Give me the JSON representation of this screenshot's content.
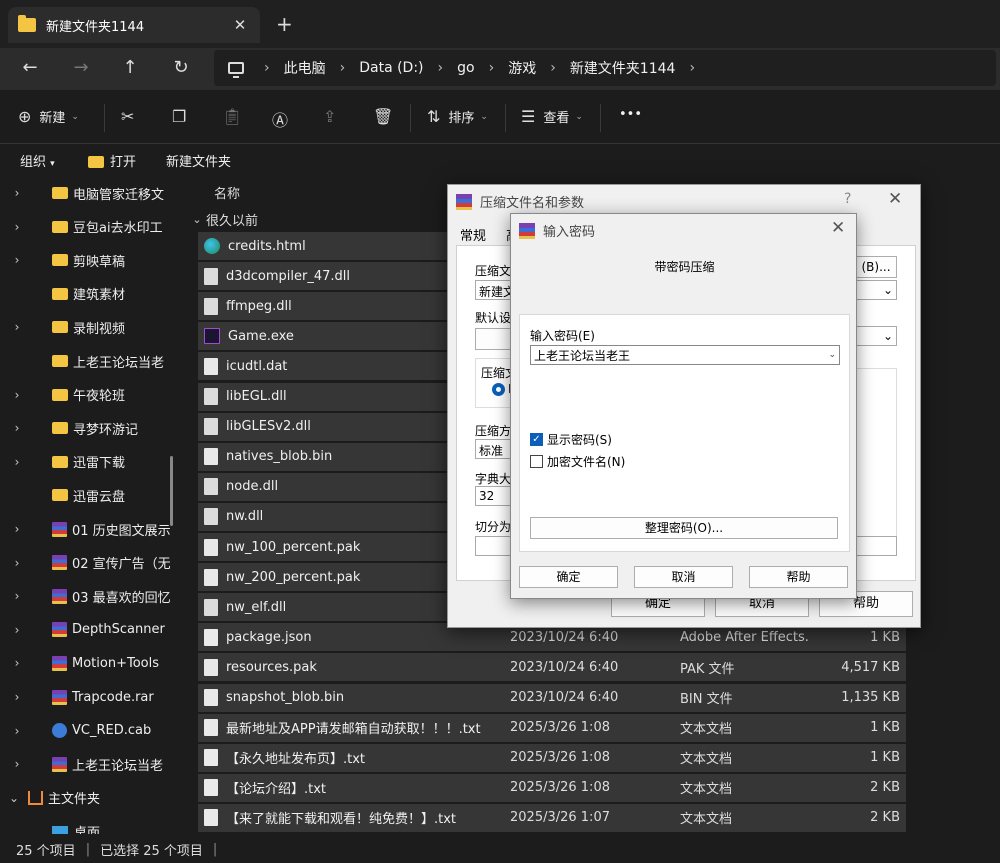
{
  "tab": {
    "title": "新建文件夹1144",
    "close": "✕",
    "new": "+"
  },
  "address": {
    "crumbs": [
      "此电脑",
      "Data (D:)",
      "go",
      "游戏",
      "新建文件夹1144"
    ]
  },
  "toolbar": {
    "new_label": "新建",
    "sort_label": "排序",
    "view_label": "查看",
    "more_label": "•••"
  },
  "subbar": {
    "organize": "组织",
    "open": "打开",
    "new_folder": "新建文件夹"
  },
  "tree": {
    "items": [
      {
        "label": "电脑管家迁移文",
        "icon": "folder",
        "chevron": true
      },
      {
        "label": "豆包ai去水印工",
        "icon": "folder",
        "chevron": true
      },
      {
        "label": "剪映草稿",
        "icon": "folder",
        "chevron": true
      },
      {
        "label": "建筑素材",
        "icon": "folder",
        "chevron": false
      },
      {
        "label": "录制视频",
        "icon": "folder",
        "chevron": true
      },
      {
        "label": "上老王论坛当老",
        "icon": "folder",
        "chevron": false
      },
      {
        "label": "午夜轮班",
        "icon": "folder",
        "chevron": true
      },
      {
        "label": "寻梦环游记",
        "icon": "folder",
        "chevron": true
      },
      {
        "label": "迅雷下载",
        "icon": "folder",
        "chevron": true
      },
      {
        "label": "迅雷云盘",
        "icon": "folder",
        "chevron": false
      },
      {
        "label": "01 历史图文展示",
        "icon": "rar",
        "chevron": true
      },
      {
        "label": "02 宣传广告（无",
        "icon": "rar",
        "chevron": true
      },
      {
        "label": "03 最喜欢的回忆",
        "icon": "rar",
        "chevron": true
      },
      {
        "label": "DepthScanner",
        "icon": "rar",
        "chevron": true
      },
      {
        "label": "Motion+Tools",
        "icon": "rar",
        "chevron": true
      },
      {
        "label": "Trapcode.rar",
        "icon": "rar",
        "chevron": true
      },
      {
        "label": "VC_RED.cab",
        "icon": "cab",
        "chevron": true
      },
      {
        "label": "上老王论坛当老",
        "icon": "rar",
        "chevron": true
      }
    ],
    "home": "主文件夹",
    "desktop": "桌面"
  },
  "list": {
    "col_name": "名称",
    "group": "很久以前",
    "files": [
      {
        "name": "credits.html",
        "icon": "edge",
        "date": "",
        "type": "",
        "size": ""
      },
      {
        "name": "d3dcompiler_47.dll",
        "icon": "dll",
        "date": "",
        "type": "",
        "size": ""
      },
      {
        "name": "ffmpeg.dll",
        "icon": "dll",
        "date": "",
        "type": "",
        "size": ""
      },
      {
        "name": "Game.exe",
        "icon": "game",
        "date": "",
        "type": "",
        "size": ""
      },
      {
        "name": "icudtl.dat",
        "icon": "file",
        "date": "",
        "type": "",
        "size": ""
      },
      {
        "name": "libEGL.dll",
        "icon": "dll",
        "date": "",
        "type": "",
        "size": ""
      },
      {
        "name": "libGLESv2.dll",
        "icon": "dll",
        "date": "",
        "type": "",
        "size": ""
      },
      {
        "name": "natives_blob.bin",
        "icon": "file",
        "date": "",
        "type": "",
        "size": ""
      },
      {
        "name": "node.dll",
        "icon": "dll",
        "date": "",
        "type": "",
        "size": ""
      },
      {
        "name": "nw.dll",
        "icon": "dll",
        "date": "",
        "type": "",
        "size": ""
      },
      {
        "name": "nw_100_percent.pak",
        "icon": "file",
        "date": "",
        "type": "",
        "size": ""
      },
      {
        "name": "nw_200_percent.pak",
        "icon": "file",
        "date": "",
        "type": "",
        "size": ""
      },
      {
        "name": "nw_elf.dll",
        "icon": "dll",
        "date": "",
        "type": "",
        "size": ""
      },
      {
        "name": "package.json",
        "icon": "txt",
        "date": "2023/10/24 6:40",
        "type": "Adobe After Effects...",
        "size": "1 KB"
      },
      {
        "name": "resources.pak",
        "icon": "file",
        "date": "2023/10/24 6:40",
        "type": "PAK 文件",
        "size": "4,517 KB"
      },
      {
        "name": "snapshot_blob.bin",
        "icon": "file",
        "date": "2023/10/24 6:40",
        "type": "BIN 文件",
        "size": "1,135 KB"
      },
      {
        "name": "最新地址及APP请发邮箱自动获取！！！.txt",
        "icon": "txt",
        "date": "2025/3/26 1:08",
        "type": "文本文档",
        "size": "1 KB"
      },
      {
        "name": "【永久地址发布页】.txt",
        "icon": "txt",
        "date": "2025/3/26 1:08",
        "type": "文本文档",
        "size": "1 KB"
      },
      {
        "name": "【论坛介绍】.txt",
        "icon": "txt",
        "date": "2025/3/26 1:08",
        "type": "文本文档",
        "size": "2 KB"
      },
      {
        "name": "【来了就能下载和观看！纯免费！】.txt",
        "icon": "txt",
        "date": "2025/3/26 1:07",
        "type": "文本文档",
        "size": "2 KB"
      }
    ]
  },
  "status": {
    "count": "25 个项目",
    "selected": "已选择 25 个项目"
  },
  "archive_dialog": {
    "title": "压缩文件名和参数",
    "help_mark": "?",
    "tab_general": "常规",
    "tab_adv": "高",
    "lbl_archive": "压缩文件",
    "archive_value": "新建文",
    "browse": "(B)...",
    "lbl_profile": "默认设置",
    "lbl_format": "压缩文",
    "radio_label": "R",
    "lbl_method": "压缩方式",
    "method_value": "标准",
    "lbl_dict": "字典大小",
    "dict_value": "32",
    "lbl_split": "切分为分",
    "ok": "确定",
    "cancel": "取消",
    "help": "帮助"
  },
  "password_dialog": {
    "title": "输入密码",
    "heading": "带密码压缩",
    "lbl_password": "输入密码(E)",
    "password_value": "上老王论坛当老王",
    "show_password": "显示密码(S)",
    "encrypt_names": "加密文件名(N)",
    "organize": "整理密码(O)...",
    "ok": "确定",
    "cancel": "取消",
    "help": "帮助"
  }
}
